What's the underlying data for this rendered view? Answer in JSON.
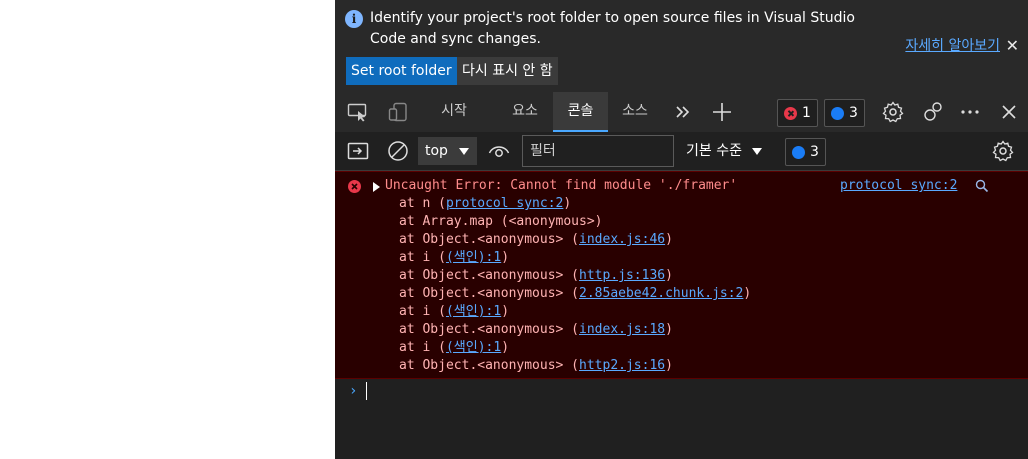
{
  "infobar": {
    "message": "Identify your project's root folder to open source files in Visual Studio Code and sync changes.",
    "learn_more": "자세히 알아보기",
    "set_root_button": "Set root folder",
    "dont_show_button": "다시 표시 안 함"
  },
  "tabs": [
    {
      "label": "시작",
      "active": false
    },
    {
      "label": "요소",
      "active": false
    },
    {
      "label": "콘솔",
      "active": true
    },
    {
      "label": "소스",
      "active": false
    }
  ],
  "counts": {
    "errors": "1",
    "messages": "3",
    "issues": "3"
  },
  "toolbar": {
    "context": "top",
    "filter_placeholder": "필터",
    "levels": "기본 수준"
  },
  "error": {
    "message": "Uncaught Error: Cannot find module './framer'",
    "source": "protocol sync:2",
    "stack": [
      {
        "prefix": "at n (",
        "link": "protocol sync:2",
        "suffix": ")"
      },
      {
        "prefix": "at Array.map (<anonymous>)",
        "link": "",
        "suffix": ""
      },
      {
        "prefix": "at Object.<anonymous> (",
        "link": "index.js:46",
        "suffix": ")"
      },
      {
        "prefix": "at i (",
        "link": "(색인):1",
        "suffix": ")"
      },
      {
        "prefix": "at Object.<anonymous> (",
        "link": "http.js:136",
        "suffix": ")"
      },
      {
        "prefix": "at Object.<anonymous> (",
        "link": "2.85aebe42.chunk.js:2",
        "suffix": ")"
      },
      {
        "prefix": "at i (",
        "link": "(색인):1",
        "suffix": ")"
      },
      {
        "prefix": "at Object.<anonymous> (",
        "link": "index.js:18",
        "suffix": ")"
      },
      {
        "prefix": "at i (",
        "link": "(색인):1",
        "suffix": ")"
      },
      {
        "prefix": "at Object.<anonymous> (",
        "link": "http2.js:16",
        "suffix": ")"
      }
    ]
  },
  "colors": {
    "accent": "#0f6cbd",
    "link": "#5aa9ff",
    "error_bg": "#290000",
    "error_text": "#ff8c8c"
  }
}
